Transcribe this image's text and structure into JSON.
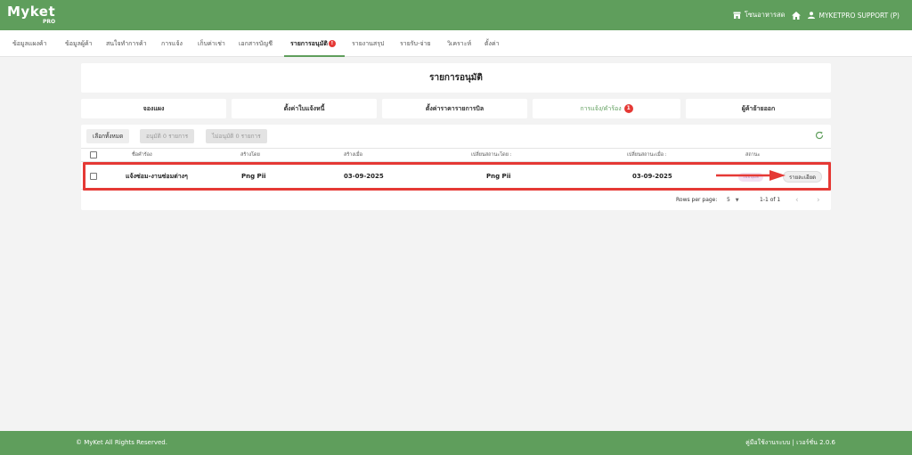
{
  "app": {
    "logo": "Myket",
    "logo_sub": "PRO"
  },
  "topbar": {
    "store": "โซนอาหารสด",
    "user": "MYKETPRO SUPPORT (P)"
  },
  "nav": {
    "items": [
      {
        "label": "ข้อมูลแผงค้า"
      },
      {
        "label": "ข้อมูลผู้ค้า"
      },
      {
        "label": "สนใจทำการค้า"
      },
      {
        "label": "การแจ้ง"
      },
      {
        "label": "เก็บค่าเช่า"
      },
      {
        "label": "เอกสารบัญชี"
      },
      {
        "label": "รายการอนุมัติ",
        "badge": "!"
      },
      {
        "label": "รายงานสรุป"
      },
      {
        "label": "รายรับ-จ่าย"
      },
      {
        "label": "วิเคราะห์"
      },
      {
        "label": "ตั้งค่า"
      }
    ]
  },
  "page": {
    "title": "รายการอนุมัติ"
  },
  "tabs": [
    {
      "label": "จองแผง"
    },
    {
      "label": "ตั้งค่าใบแจ้งหนี้"
    },
    {
      "label": "ตั้งค่าราคารายการบิล"
    },
    {
      "label": "การแจ้ง/คำร้อง",
      "badge": "1"
    },
    {
      "label": "ผู้ค้าย้ายออก"
    }
  ],
  "toolbar": {
    "select_all": "เลือกทั้งหมด",
    "approve": "อนุมัติ 0 รายการ",
    "reject": "ไม่อนุมัติ 0 รายการ"
  },
  "table": {
    "columns": [
      "ชื่อคำร้อง",
      "สร้างโดย",
      "สร้างเมื่อ",
      "เปลี่ยนสถานะโดย :",
      "เปลี่ยนสถานะเมื่อ :",
      "สถานะ"
    ],
    "rows": [
      {
        "name": "แจ้งซ่อม-งานซ่อมต่างๆ",
        "created_by": "Png Pii",
        "created_at": "03-09-2025",
        "status_by": "Png Pii",
        "status_at": "03-09-2025",
        "status": "รออนุมัติ",
        "action": "รายละเอียด"
      }
    ]
  },
  "pagination": {
    "rows_label": "Rows per page:",
    "rows_value": "5",
    "range": "1-1 of 1"
  },
  "footer": {
    "copyright": "© MyKet All Rights Reserved.",
    "right": "คู่มือใช้งานระบบ | เวอร์ชั่น 2.0.6"
  },
  "colors": {
    "brand": "#5f9e5c",
    "highlight": "#e53935"
  }
}
